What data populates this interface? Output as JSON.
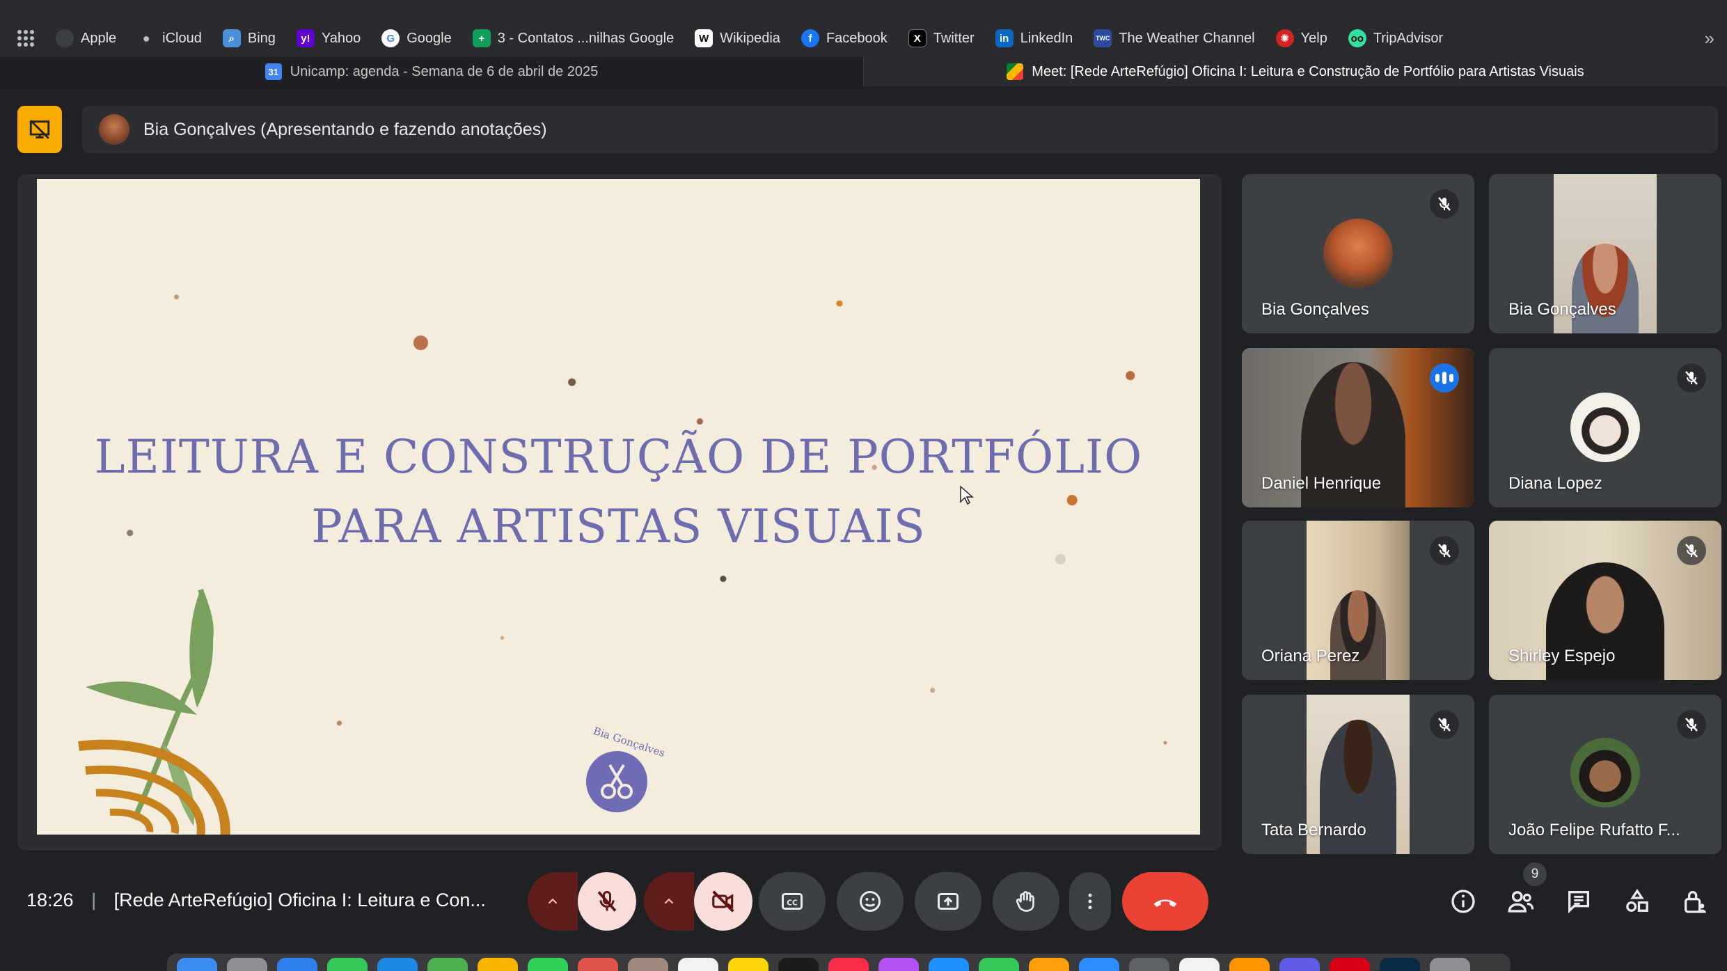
{
  "bookmarks": [
    {
      "label": "Apple",
      "icon": "apple-icon",
      "color": "#3c4043"
    },
    {
      "label": "iCloud",
      "icon": "apple-icon",
      "color": "#3c4043"
    },
    {
      "label": "Bing",
      "icon": "search-icon",
      "color": "#4a90d9"
    },
    {
      "label": "Yahoo",
      "icon": "yahoo-icon",
      "color": "#6001d2"
    },
    {
      "label": "Google",
      "icon": "google-icon",
      "color": "#ffffff"
    },
    {
      "label": "3 - Contatos ...nilhas Google",
      "icon": "sheets-icon",
      "color": "#0f9d58"
    },
    {
      "label": "Wikipedia",
      "icon": "wikipedia-icon",
      "color": "#ffffff"
    },
    {
      "label": "Facebook",
      "icon": "facebook-icon",
      "color": "#1877f2"
    },
    {
      "label": "Twitter",
      "icon": "x-icon",
      "color": "#000000"
    },
    {
      "label": "LinkedIn",
      "icon": "linkedin-icon",
      "color": "#0a66c2"
    },
    {
      "label": "The Weather Channel",
      "icon": "weather-icon",
      "color": "#2e4a9e"
    },
    {
      "label": "Yelp",
      "icon": "yelp-icon",
      "color": "#d32323"
    },
    {
      "label": "TripAdvisor",
      "icon": "tripadvisor-icon",
      "color": "#34e0a1"
    }
  ],
  "tabs": [
    {
      "title": "Unicamp: agenda - Semana de 6 de abril de 2025",
      "icon": "calendar-icon",
      "icon_text": "31",
      "active": false
    },
    {
      "title": "Meet: [Rede ArteRefúgio] Oficina I: Leitura e Construção de Portfólio para Artistas Visuais",
      "icon": "meet-icon",
      "active": true
    }
  ],
  "presenter": {
    "label": "Bia Gonçalves (Apresentando e fazendo anotações)"
  },
  "slide": {
    "title_line1": "LEITURA E CONSTRUÇÃO DE PORTFÓLIO",
    "title_line2": "PARA ARTISTAS VISUAIS",
    "logo_text": "Bia Gonçalves"
  },
  "participants": [
    {
      "name": "Bia Gonçalves",
      "muted": true,
      "type": "avatar"
    },
    {
      "name": "Bia Gonçalves",
      "muted": false,
      "type": "video"
    },
    {
      "name": "Daniel Henrique",
      "muted": false,
      "type": "video",
      "speaking": true
    },
    {
      "name": "Diana Lopez",
      "muted": true,
      "type": "avatar"
    },
    {
      "name": "Oriana Perez",
      "muted": true,
      "type": "video"
    },
    {
      "name": "Shirley Espejo",
      "muted": true,
      "type": "video"
    },
    {
      "name": "Tata Bernardo",
      "muted": true,
      "type": "video"
    },
    {
      "name": "João Felipe Rufatto F...",
      "muted": true,
      "type": "avatar"
    }
  ],
  "meeting": {
    "time": "18:26",
    "separator": "|",
    "title": "[Rede ArteRefúgio] Oficina I: Leitura e Con...",
    "participant_count": "9"
  },
  "colors": {
    "accent_blue": "#8ab4f8",
    "hangup_red": "#ea4335",
    "present_yellow": "#f9ab00",
    "muted_pink": "#f9dedc",
    "slide_title": "#6d6cae"
  }
}
